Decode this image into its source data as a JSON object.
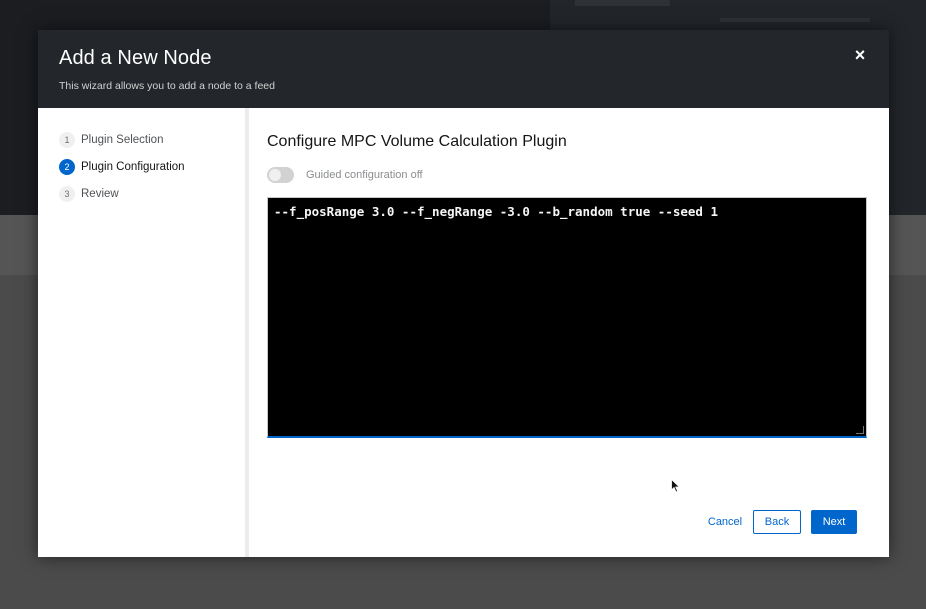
{
  "modal": {
    "title": "Add a New Node",
    "description": "This wizard allows you to add a node to a feed",
    "close_symbol": "×"
  },
  "nav": {
    "steps": [
      {
        "number": "1",
        "label": "Plugin Selection",
        "active": false
      },
      {
        "number": "2",
        "label": "Plugin Configuration",
        "active": true
      },
      {
        "number": "3",
        "label": "Review",
        "active": false
      }
    ]
  },
  "main": {
    "title": "Configure MPC Volume Calculation Plugin",
    "toggle_label": "Guided configuration off",
    "toggle_on": false,
    "code_value": "--f_posRange 3.0 --f_negRange -3.0 --b_random true --seed 1"
  },
  "footer": {
    "cancel_label": "Cancel",
    "back_label": "Back",
    "next_label": "Next"
  },
  "colors": {
    "accent": "#0066cc",
    "header_bg": "#23262b",
    "code_bg": "#000000"
  },
  "icons": {
    "close": "close-icon",
    "cursor": "mouse-pointer-icon"
  }
}
